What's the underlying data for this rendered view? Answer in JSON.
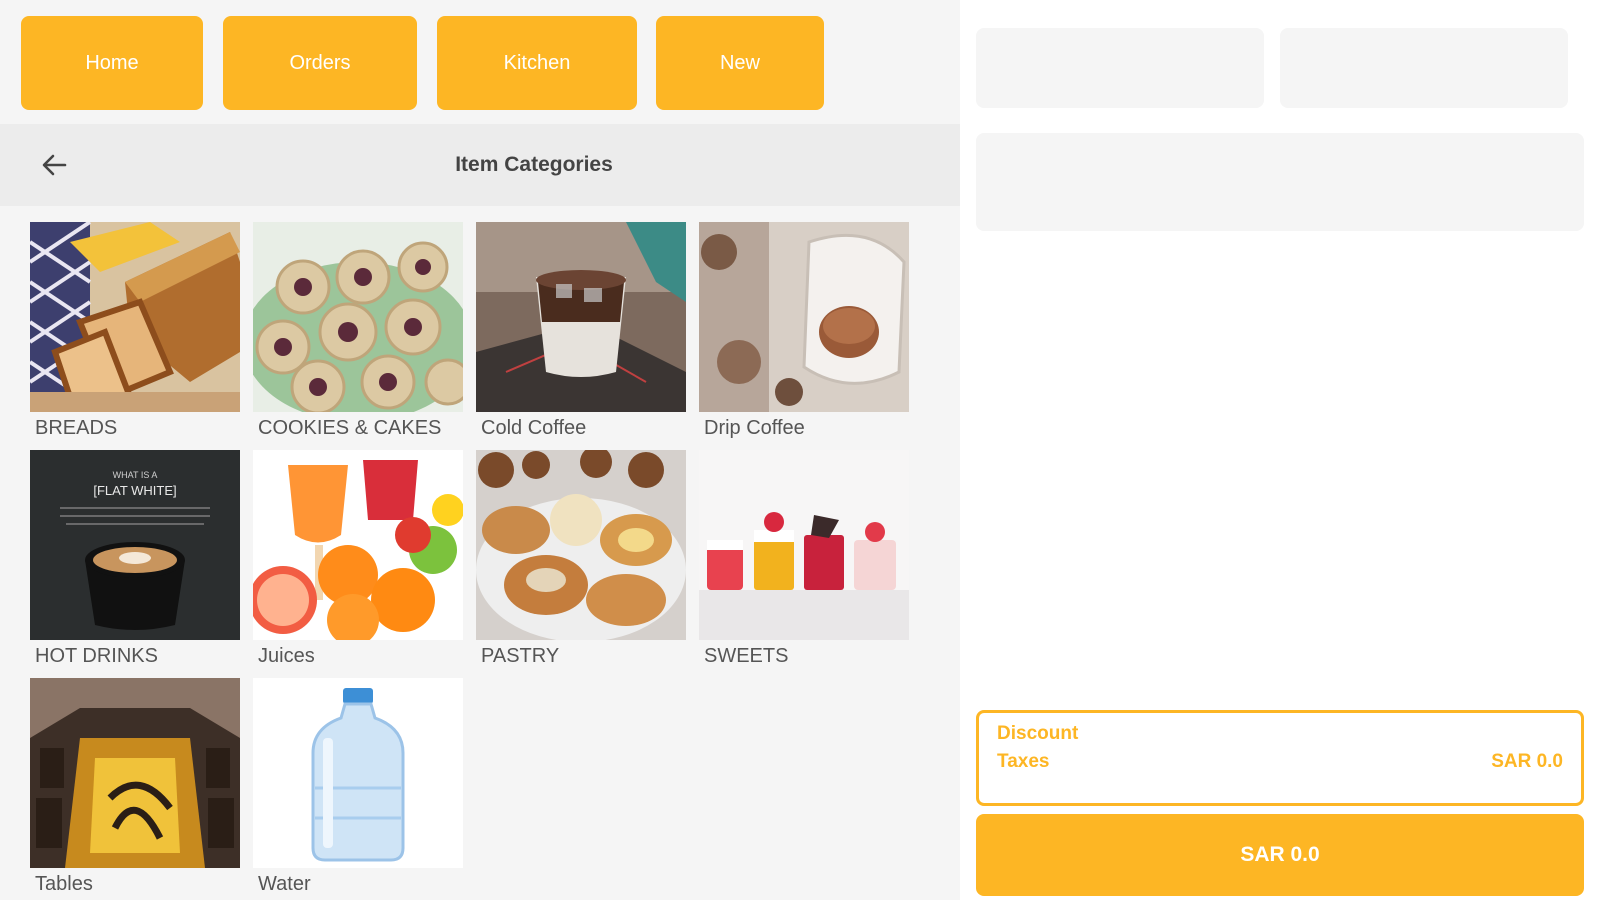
{
  "nav": {
    "home": "Home",
    "orders": "Orders",
    "kitchen": "Kitchen",
    "new": "New"
  },
  "header": {
    "title": "Item Categories",
    "back_icon": "arrow-left-icon"
  },
  "categories": [
    {
      "label": "BREADS"
    },
    {
      "label": "COOKIES & CAKES"
    },
    {
      "label": "Cold Coffee"
    },
    {
      "label": "Drip Coffee"
    },
    {
      "label": "HOT DRINKS"
    },
    {
      "label": "Juices"
    },
    {
      "label": "PASTRY"
    },
    {
      "label": "SWEETS"
    },
    {
      "label": "Tables"
    },
    {
      "label": "Water"
    }
  ],
  "hot_drinks_board": {
    "line1": "WHAT IS A",
    "line2": "[FLAT WHITE]"
  },
  "order_panel": {
    "discount_label": "Discount",
    "taxes_label": "Taxes",
    "taxes_value": "SAR 0.0",
    "pay_label": "SAR 0.0"
  },
  "colors": {
    "accent": "#fdb624",
    "panel_bg": "#f5f5f5",
    "header_bg": "#ececec"
  }
}
